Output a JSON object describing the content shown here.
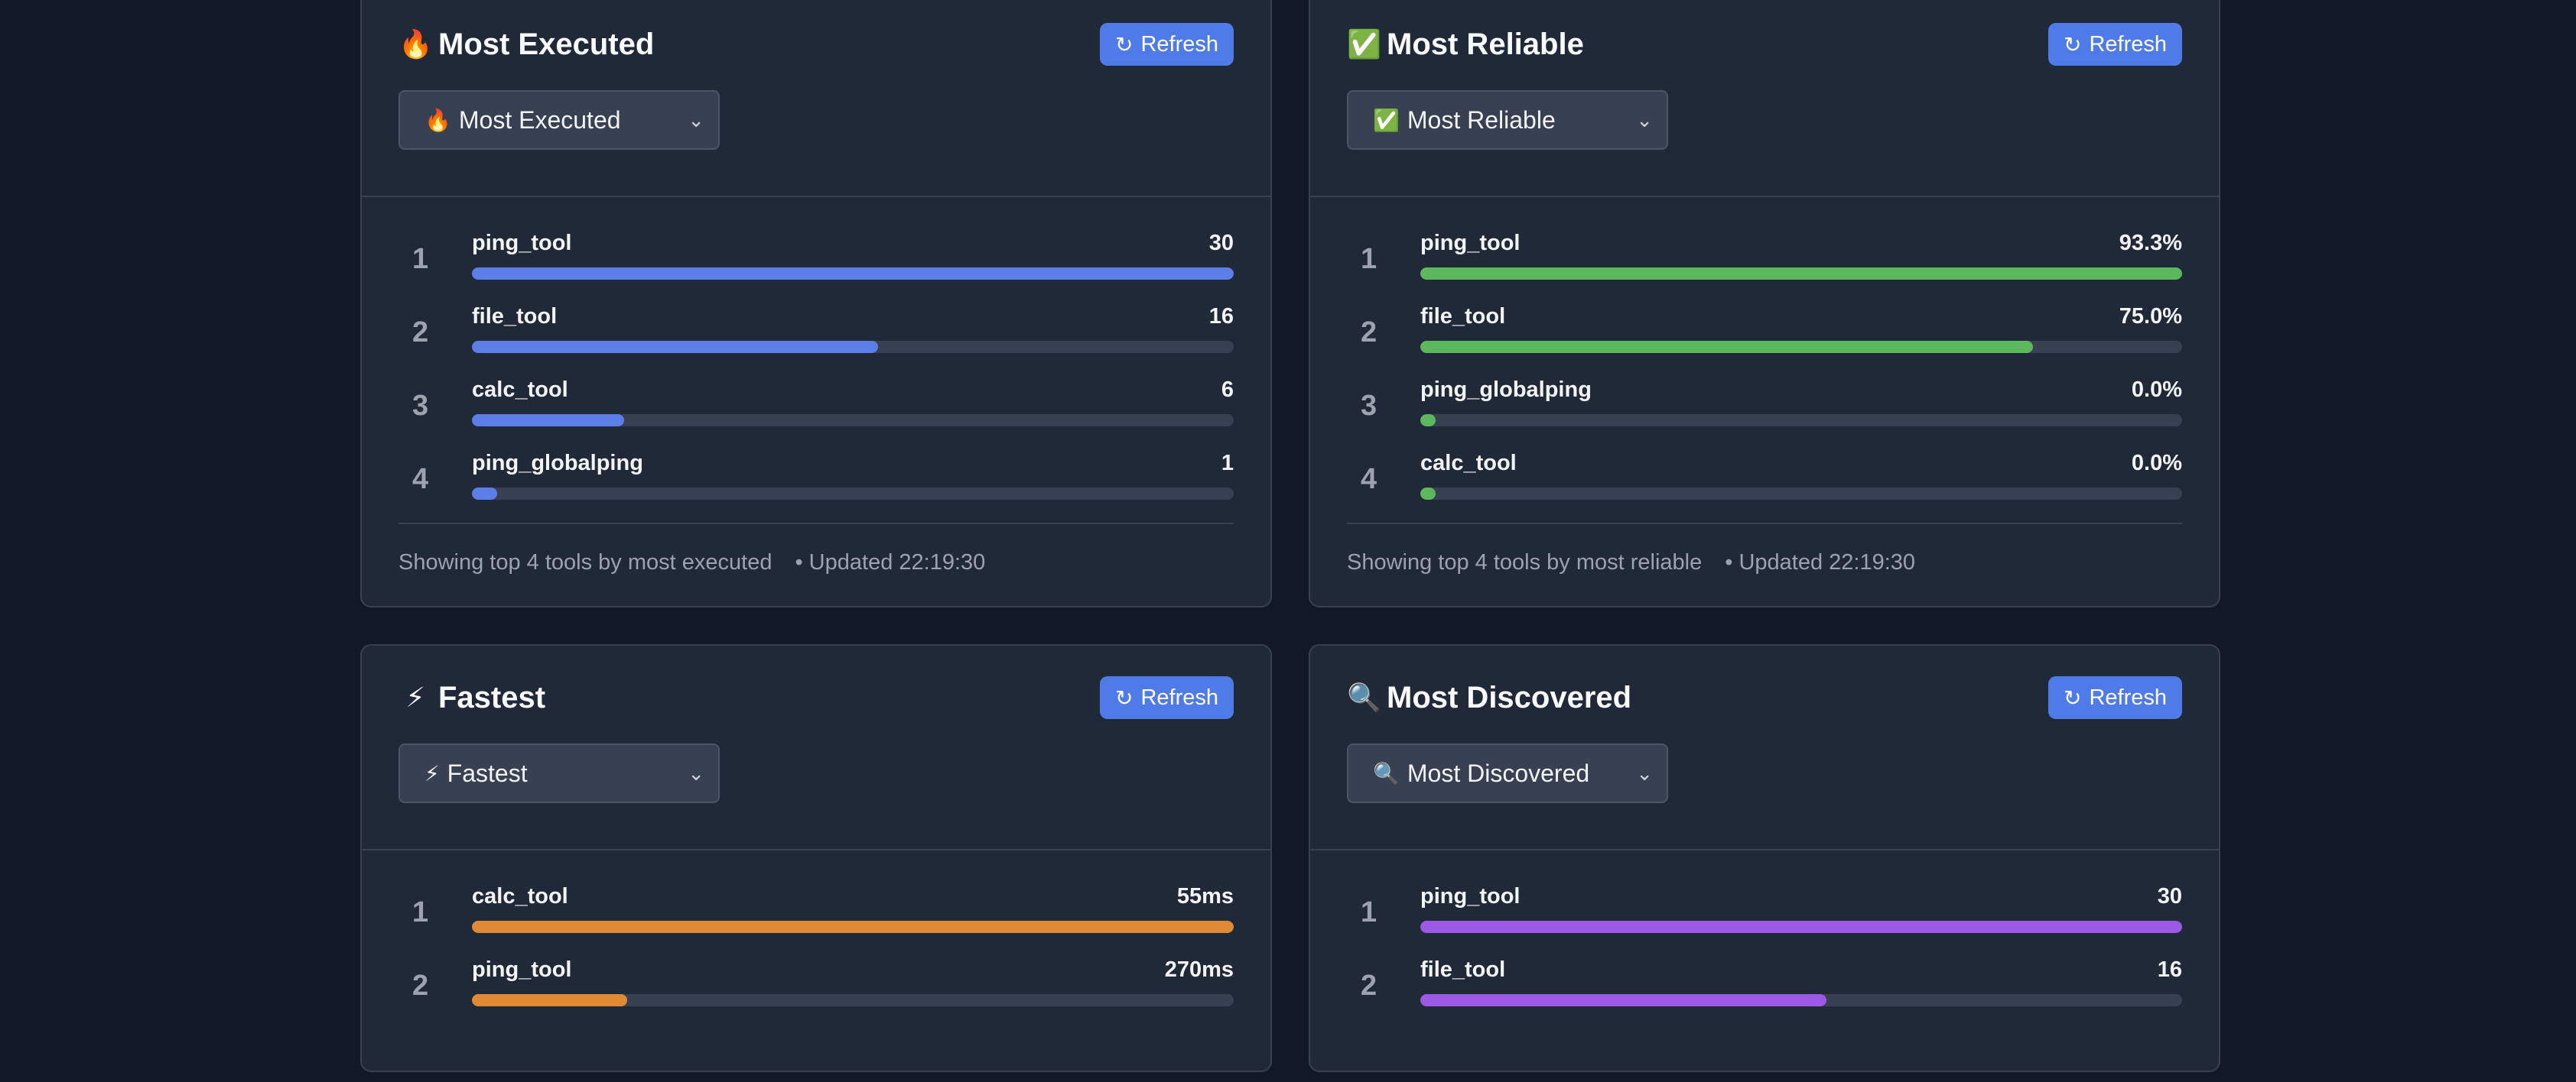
{
  "cards": [
    {
      "title": "Most Executed",
      "emoji": "🔥",
      "refresh_label": "Refresh",
      "select_value": "Most Executed",
      "color": "#5b7fe6",
      "rows": [
        {
          "rank": "1",
          "name": "ping_tool",
          "value": "30",
          "fraction": 1.0
        },
        {
          "rank": "2",
          "name": "file_tool",
          "value": "16",
          "fraction": 0.533
        },
        {
          "rank": "3",
          "name": "calc_tool",
          "value": "6",
          "fraction": 0.2
        },
        {
          "rank": "4",
          "name": "ping_globalping",
          "value": "1",
          "fraction": 0.033
        }
      ],
      "footer_text": "Showing top 4 tools by most executed",
      "updated": "• Updated 22:19:30"
    },
    {
      "title": "Most Reliable",
      "emoji": "✅",
      "refresh_label": "Refresh",
      "select_value": "Most Reliable",
      "color": "#5cb85c",
      "rows": [
        {
          "rank": "1",
          "name": "ping_tool",
          "value": "93.3%",
          "fraction": 1.0
        },
        {
          "rank": "2",
          "name": "file_tool",
          "value": "75.0%",
          "fraction": 0.804
        },
        {
          "rank": "3",
          "name": "ping_globalping",
          "value": "0.0%",
          "fraction": 0.02
        },
        {
          "rank": "4",
          "name": "calc_tool",
          "value": "0.0%",
          "fraction": 0.02
        }
      ],
      "footer_text": "Showing top 4 tools by most reliable",
      "updated": "• Updated 22:19:30"
    },
    {
      "title": "Fastest",
      "emoji": "⚡",
      "refresh_label": "Refresh",
      "select_value": "Fastest",
      "color": "#e08a36",
      "rows": [
        {
          "rank": "1",
          "name": "calc_tool",
          "value": "55ms",
          "fraction": 1.0
        },
        {
          "rank": "2",
          "name": "ping_tool",
          "value": "270ms",
          "fraction": 0.204
        }
      ]
    },
    {
      "title": "Most Discovered",
      "emoji": "🔍",
      "refresh_label": "Refresh",
      "select_value": "Most Discovered",
      "color": "#9b59e6",
      "rows": [
        {
          "rank": "1",
          "name": "ping_tool",
          "value": "30",
          "fraction": 1.0
        },
        {
          "rank": "2",
          "name": "file_tool",
          "value": "16",
          "fraction": 0.533
        }
      ]
    }
  ]
}
